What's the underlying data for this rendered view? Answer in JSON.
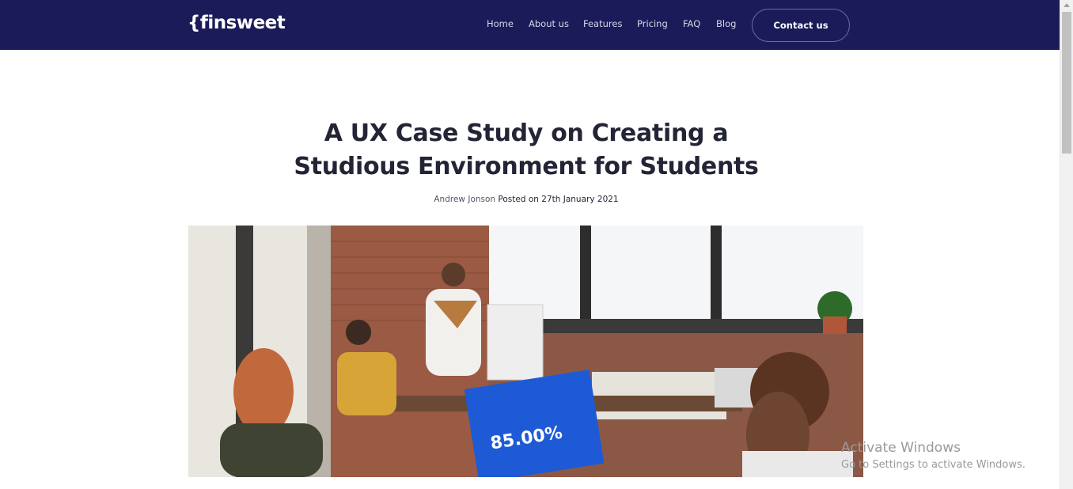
{
  "brand": {
    "logo_text": "{finsweet"
  },
  "nav": {
    "items": [
      "Home",
      "About us",
      "Features",
      "Pricing",
      "FAQ",
      "Blog"
    ],
    "contact_label": "Contact us"
  },
  "article": {
    "title_line1": "A UX Case Study on Creating a",
    "title_line2": "Studious Environment for Students",
    "author": "Andrew Jonson",
    "posted": "Posted on 27th January 2021",
    "hero_screen_text": "85.00%"
  },
  "os_watermark": {
    "line1": "Activate Windows",
    "line2": "Go to Settings to activate Windows."
  },
  "colors": {
    "nav_bg": "#1c1b5a",
    "heading": "#232536"
  }
}
